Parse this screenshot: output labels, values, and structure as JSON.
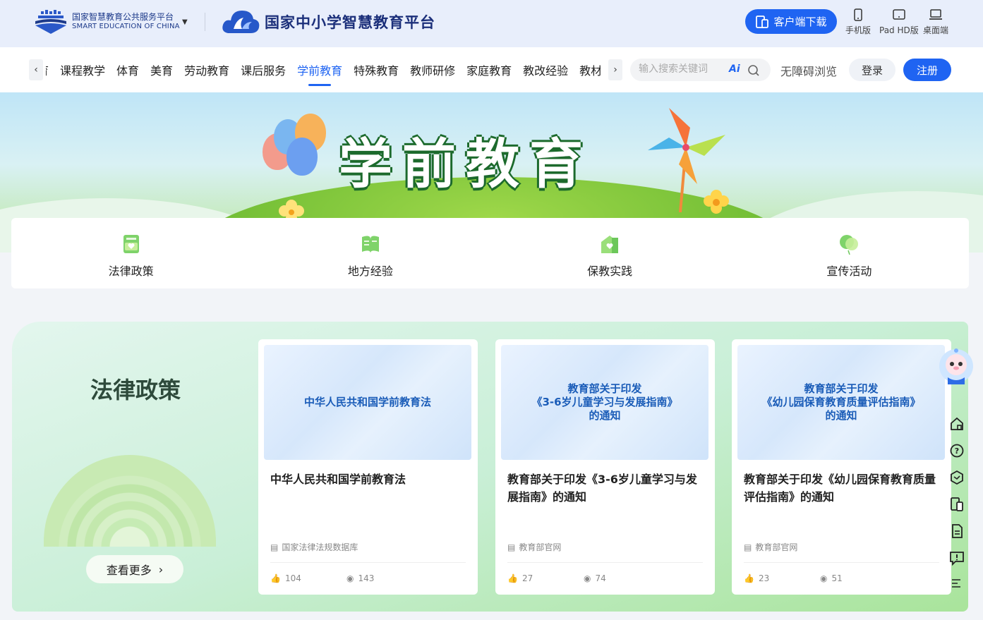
{
  "header": {
    "org_name_cn": "国家智慧教育公共服务平台",
    "org_name_en": "SMART EDUCATION OF CHINA",
    "platform_name": "国家中小学智慧教育平台",
    "download_label": "客户端下载",
    "devices": [
      "手机版",
      "Pad HD版",
      "桌面端"
    ]
  },
  "nav": {
    "partial_left": "育",
    "items": [
      "课程教学",
      "体育",
      "美育",
      "劳动教育",
      "课后服务",
      "学前教育",
      "特殊教育",
      "教师研修",
      "家庭教育",
      "教改经验",
      "教材"
    ],
    "active_index": 5,
    "search_placeholder": "输入搜索关键词",
    "ai_label": "Ai",
    "accessibility": "无障碍浏览",
    "login": "登录",
    "register": "注册"
  },
  "banner": {
    "title": "学前教育"
  },
  "categories": [
    "法律政策",
    "地方经验",
    "保教实践",
    "宣传活动"
  ],
  "section": {
    "title": "法律政策",
    "more_label": "查看更多",
    "cards": [
      {
        "thumb_lines": [
          "中华人民共和国学前教育法"
        ],
        "title": "中华人民共和国学前教育法",
        "source": "国家法律法规数据库",
        "likes": "104",
        "views": "143"
      },
      {
        "thumb_lines": [
          "教育部关于印发",
          "《3-6岁儿童学习与发展指南》",
          "的通知"
        ],
        "title": "教育部关于印发《3-6岁儿童学习与发展指南》的通知",
        "source": "教育部官网",
        "likes": "27",
        "views": "74"
      },
      {
        "thumb_lines": [
          "教育部关于印发",
          "《幼儿园保育教育质量评估指南》",
          "的通知"
        ],
        "title": "教育部关于印发《幼儿园保育教育质量评估指南》的通知",
        "source": "教育部官网",
        "likes": "23",
        "views": "51"
      }
    ]
  },
  "colors": {
    "primary": "#1f64f2",
    "navy": "#1b2f7a"
  }
}
